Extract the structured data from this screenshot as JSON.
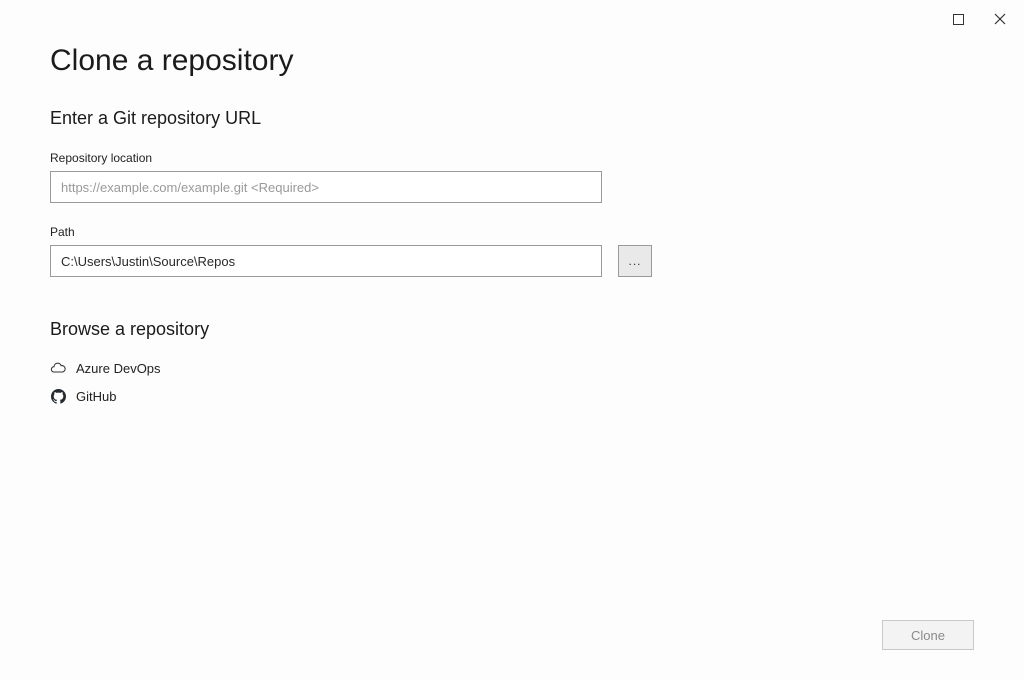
{
  "title": "Clone a repository",
  "section_enter": "Enter a Git repository URL",
  "repo_location": {
    "label": "Repository location",
    "placeholder": "https://example.com/example.git <Required>",
    "value": ""
  },
  "path": {
    "label": "Path",
    "value": "C:\\Users\\Justin\\Source\\Repos"
  },
  "browse_btn_label": "...",
  "browse_section": "Browse a repository",
  "providers": {
    "azure": "Azure DevOps",
    "github": "GitHub"
  },
  "clone_label": "Clone"
}
